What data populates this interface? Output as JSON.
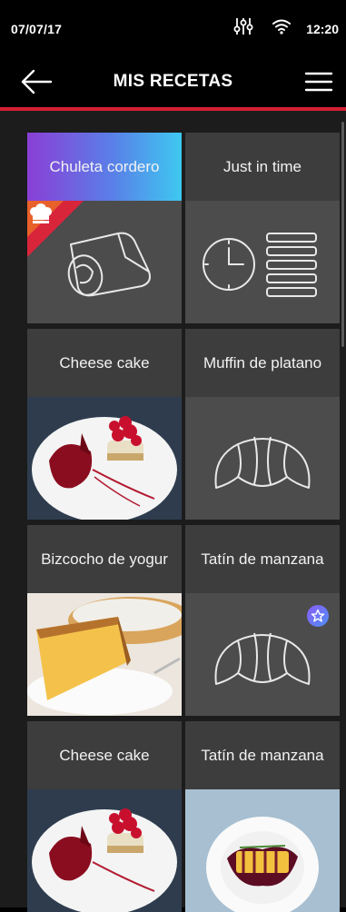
{
  "status_bar": {
    "date": "07/07/17",
    "time": "12:20",
    "icons": [
      "equalizer-icon",
      "wifi-icon"
    ]
  },
  "header": {
    "title": "MIS RECETAS",
    "back_icon": "arrow-left-icon",
    "menu_icon": "hamburger-menu-icon"
  },
  "colors": {
    "accent_red": "#d51f34",
    "tile_label_bg": "#3d3d3d",
    "tile_body_bg": "#4c4c4c",
    "gradient_start": "#8a3fd6",
    "gradient_end": "#3ec8f0"
  },
  "recipes": [
    {
      "label": "Chuleta cordero",
      "image": "lamb-chop-outline-icon",
      "badge": "chef-hat-icon",
      "highlighted": true
    },
    {
      "label": "Just in time",
      "image": "clock-trays-icon"
    },
    {
      "label": "Cheese cake",
      "image": "cheesecake-photo"
    },
    {
      "label": "Muffin de platano",
      "image": "croissant-icon"
    },
    {
      "label": "Bizcocho de yogur",
      "image": "yogurt-cake-photo"
    },
    {
      "label": "Tatín de manzana",
      "image": "croissant-icon",
      "badge": "star-icon"
    },
    {
      "label": "Cheese cake",
      "image": "cheesecake-photo"
    },
    {
      "label": "Tatín de manzana",
      "image": "tatin-plate-photo"
    }
  ]
}
